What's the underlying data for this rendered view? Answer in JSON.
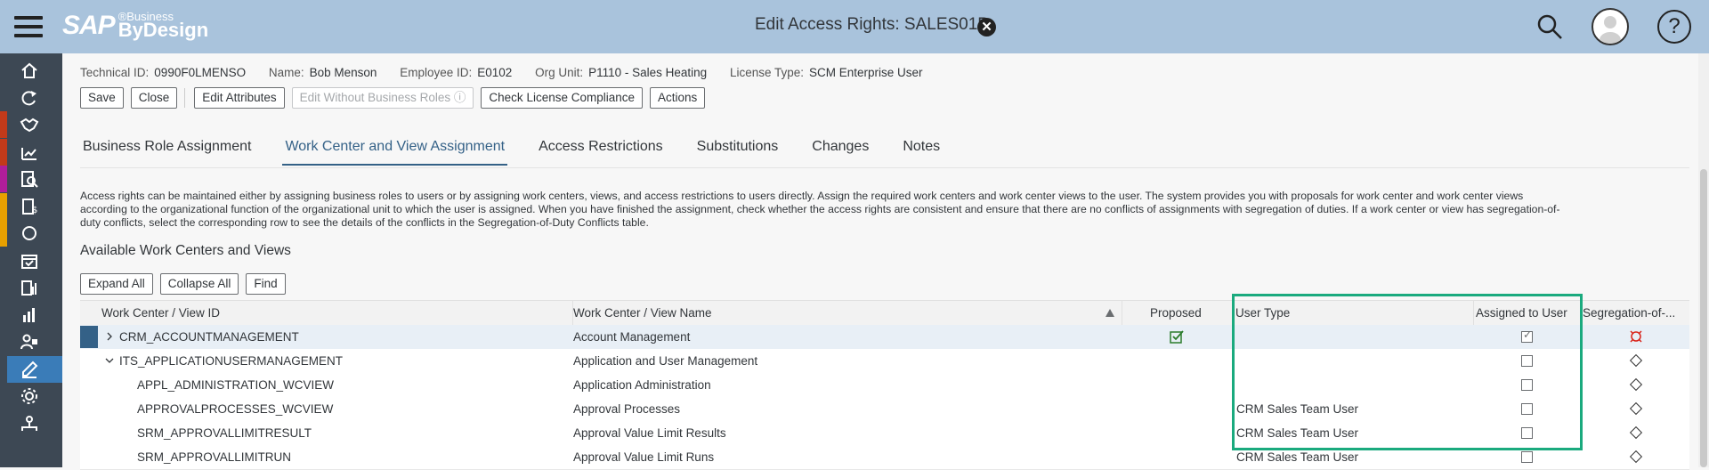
{
  "shell": {
    "logo_sap": "SAP",
    "logo_business": "®Business",
    "logo_bydesign": "ByDesign",
    "title": "Edit Access Rights: SALES01P",
    "icons": [
      "menu-icon",
      "close-icon",
      "search-icon",
      "user-avatar-icon",
      "help-icon"
    ]
  },
  "nav": {
    "items": [
      {
        "icon": "home-icon",
        "stripe": "#3d4854"
      },
      {
        "icon": "refresh-icon",
        "stripe": "#3d4854"
      },
      {
        "icon": "handshake-icon",
        "stripe": "#c23a1a"
      },
      {
        "icon": "chart-star-icon",
        "stripe": "#c23a1a"
      },
      {
        "icon": "search-doc-icon",
        "stripe": "#b01e9a"
      },
      {
        "icon": "invoice-icon",
        "stripe": "#e8a000"
      },
      {
        "icon": "circle-icon",
        "stripe": "#e8a000"
      },
      {
        "icon": "calendar-icon",
        "stripe": "#3d4854"
      },
      {
        "icon": "report-icon",
        "stripe": "#3d4854"
      },
      {
        "icon": "bar-chart-icon",
        "stripe": "#3d4854"
      },
      {
        "icon": "user-lock-icon",
        "stripe": "#3d4854"
      },
      {
        "icon": "edit-icon",
        "stripe": "#3d4854",
        "active": true
      },
      {
        "icon": "settings-icon",
        "stripe": "#3d4854"
      },
      {
        "icon": "org-icon",
        "stripe": "#3d4854"
      }
    ]
  },
  "info": {
    "technical_id_label": "Technical ID:",
    "technical_id": "0990F0LMENSO",
    "name_label": "Name:",
    "name": "Bob Menson",
    "employee_id_label": "Employee ID:",
    "employee_id": "E0102",
    "org_unit_label": "Org Unit:",
    "org_unit": "P1110 - Sales Heating",
    "license_label": "License Type:",
    "license": "SCM Enterprise User"
  },
  "toolbar": {
    "save": "Save",
    "close": "Close",
    "edit_attributes": "Edit Attributes",
    "edit_without_roles": "Edit Without Business Roles ⓘ",
    "check_license": "Check License Compliance",
    "actions": "Actions"
  },
  "tabs": [
    "Business Role Assignment",
    "Work Center and View Assignment",
    "Access Restrictions",
    "Substitutions",
    "Changes",
    "Notes"
  ],
  "description_lines": [
    "Access rights can be maintained either by assigning business roles to users or by assigning work centers, views, and access restrictions to users directly. Assign the required work centers and work center views to the user. The system provides you with proposals for work center and work center views",
    "according to the organizational function of the organizational unit to which the user is assigned. When you have finished the assignment, check whether the access rights are consistent and ensure that there are no conflicts of assignments with segregation of duties. If a work center or view has segregation-of-",
    "duty conflicts, select the corresponding row to see the details of the conflicts in the Segregation-of-Duty Conflicts table."
  ],
  "section_title": "Available Work Centers and Views",
  "section_toolbar": {
    "expand_all": "Expand All",
    "collapse_all": "Collapse All",
    "find": "Find"
  },
  "table": {
    "headers": {
      "id": "Work Center / View ID",
      "name": "Work Center / View Name",
      "proposed": "Proposed",
      "user_type": "User Type",
      "assigned": "Assigned to User",
      "segregation": "Segregation-of-..."
    },
    "rows": [
      {
        "id": "CRM_ACCOUNTMANAGEMENT",
        "name": "Account Management",
        "proposed": true,
        "user_type": "",
        "assigned": true,
        "level": 0,
        "expander": "right",
        "selected": true,
        "conflict": true
      },
      {
        "id": "ITS_APPLICATIONUSERMANAGEMENT",
        "name": "Application and User Management",
        "proposed": false,
        "user_type": "",
        "assigned": false,
        "level": 0,
        "expander": "down"
      },
      {
        "id": "APPL_ADMINISTRATION_WCVIEW",
        "name": "Application Administration",
        "proposed": false,
        "user_type": "",
        "assigned": false,
        "level": 1
      },
      {
        "id": "APPROVALPROCESSES_WCVIEW",
        "name": "Approval Processes",
        "proposed": false,
        "user_type": "CRM Sales Team User",
        "assigned": false,
        "level": 1
      },
      {
        "id": "SRM_APPROVALLIMITRESULT",
        "name": "Approval Value Limit Results",
        "proposed": false,
        "user_type": "CRM Sales Team User",
        "assigned": false,
        "level": 1
      },
      {
        "id": "SRM_APPROVALLIMITRUN",
        "name": "Approval Value Limit Runs",
        "proposed": false,
        "user_type": "CRM Sales Team User",
        "assigned": false,
        "level": 1
      }
    ]
  },
  "colors": {
    "highlight": "#1aaa7e",
    "accent": "#346187",
    "proposed_check": "#2b7c2b",
    "conflict": "#d9241a"
  }
}
